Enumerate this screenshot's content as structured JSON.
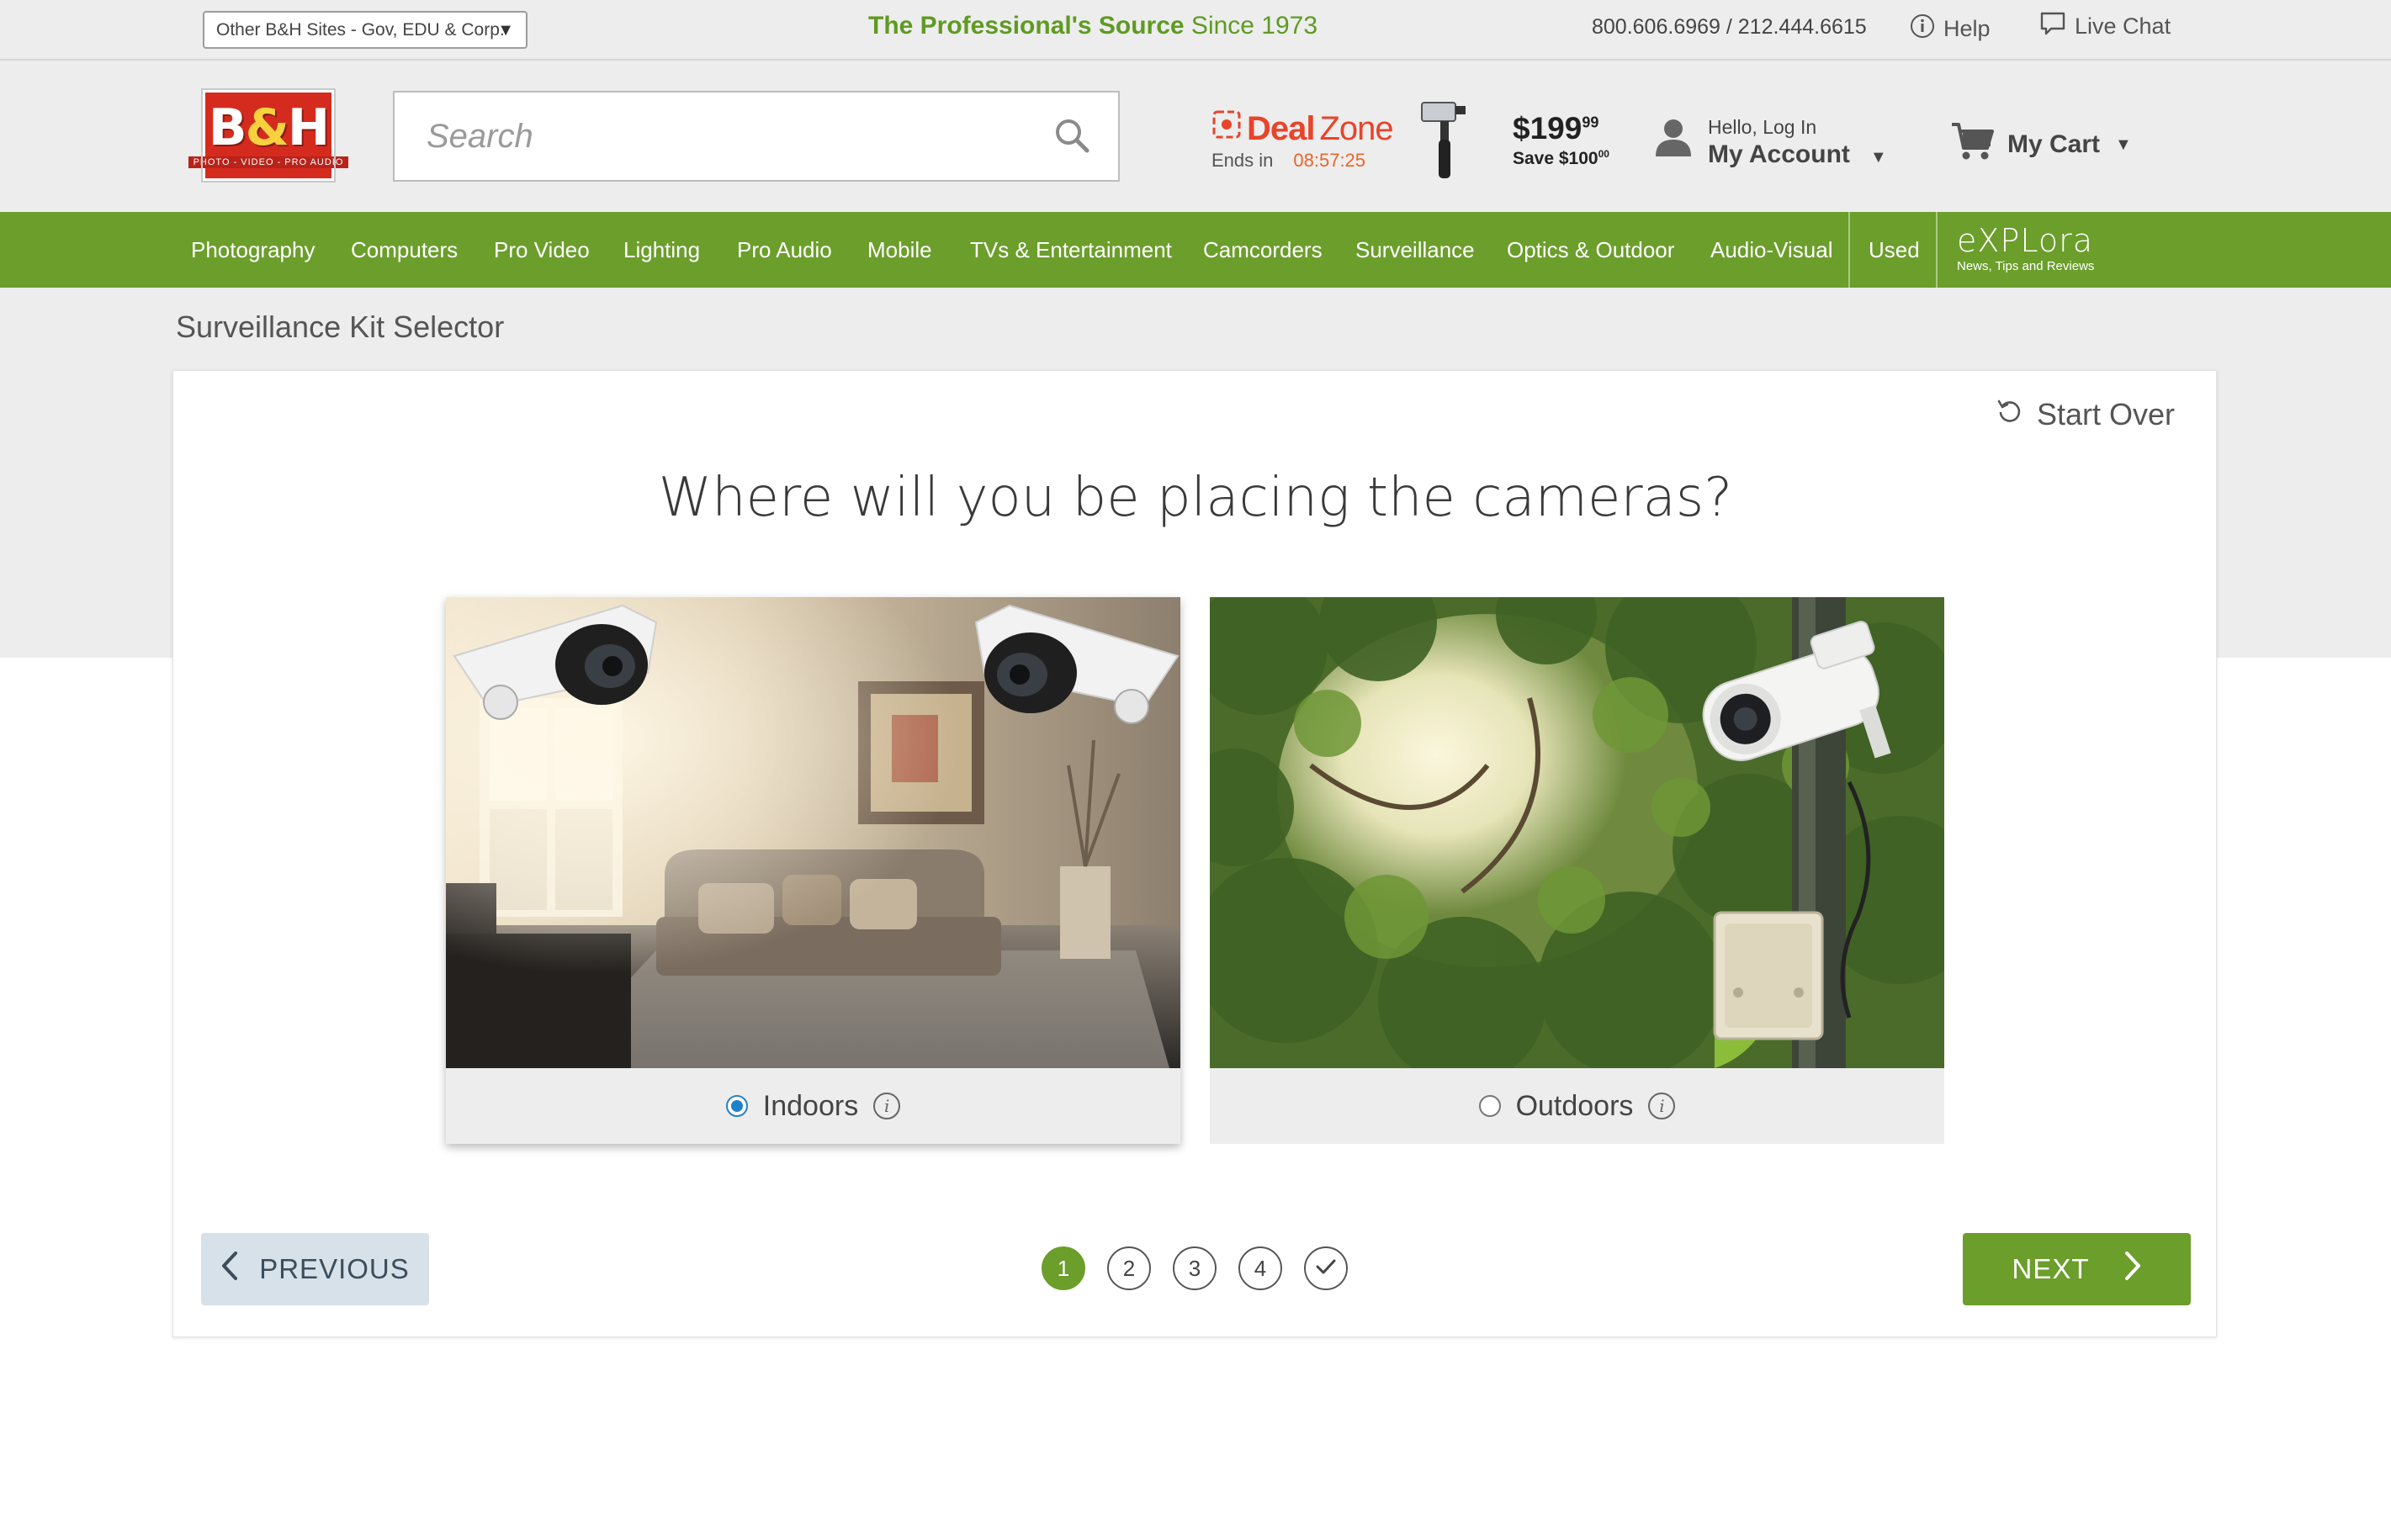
{
  "utility": {
    "sites_select": "Other B&H Sites - Gov, EDU & Corp.",
    "tagline_bold": "The Professional's Source",
    "tagline_rest": " Since 1973",
    "phones": "800.606.6969 / 212.444.6615",
    "help": "Help",
    "live_chat": "Live Chat"
  },
  "header": {
    "logo_mark_b": "B",
    "logo_mark_amp": "&",
    "logo_mark_h": "H",
    "logo_sub": "PHOTO - VIDEO - PRO AUDIO",
    "search_placeholder": "Search",
    "deal_zone": {
      "deal": "Deal",
      "zone": "Zone",
      "ends_in": "Ends in",
      "timer": "08:57:25"
    },
    "deal_price": {
      "dollars": "$199",
      "cents": "99",
      "save": "Save $100",
      "save_cents": "00"
    },
    "account": {
      "hello": "Hello, Log In",
      "my_account": "My Account"
    },
    "cart": "My Cart"
  },
  "nav": {
    "items": [
      "Photography",
      "Computers",
      "Pro Video",
      "Lighting",
      "Pro Audio",
      "Mobile",
      "TVs & Entertainment",
      "Camcorders",
      "Surveillance",
      "Optics & Outdoor",
      "Audio-Visual",
      "Used"
    ],
    "explora_logo": "eXPLora",
    "explora_sub": "News, Tips and Reviews"
  },
  "page": {
    "title": "Surveillance Kit Selector",
    "start_over": "Start Over",
    "question": "Where will you be placing the cameras?",
    "options": [
      {
        "label": "Indoors",
        "selected": true
      },
      {
        "label": "Outdoors",
        "selected": false
      }
    ],
    "previous": "PREVIOUS",
    "next": "NEXT",
    "steps": [
      "1",
      "2",
      "3",
      "4"
    ],
    "current_step": 1
  },
  "colors": {
    "brand_green": "#6b9e2b",
    "brand_red": "#d52b1e",
    "deal_orange": "#e8442a",
    "radio_blue": "#1f82c9"
  }
}
